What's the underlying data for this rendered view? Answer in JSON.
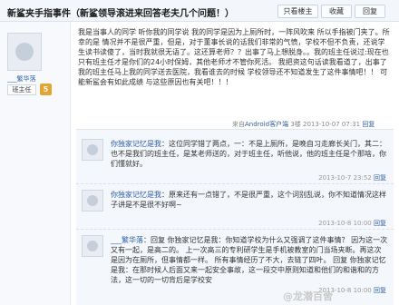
{
  "header": {
    "title": "新鲨夹手指事件（新鲨领导滚进来回答老夫几个问题！）",
    "buttons": {
      "only_author": "只看楼主",
      "favorite": "收藏",
      "reply": "回复"
    }
  },
  "op": {
    "username": "___繁华落",
    "role_badge": "班主任",
    "level_badge": "5",
    "body": "我是当事人的同学 听你我的同学说 我的同学是因为上厕所时，一阵风吹来 所以手指被门夹了。所幸的是 情况并不是很严重，但是，对于董事长说的话我们非常的气愤，学校不但不负责，还说学生读书读傻了，当时我就很无语了。这还算老师？？出事了马上想脱身。。我的班主任说过:现在也只有班主任才是你们的24小时保姆，其他老师才不管你死活。 我把资这句话读我看道了，出事了我的班主任马上我的同学送去医院，我看谁去的时候 学校领导还不知道发生了这件事情吧！！ 可能新鲨会有如此成绩 与这些原因也有关吧！！！",
    "meta": {
      "device_prefix": "来自",
      "device": "Android客户端",
      "floor": "3楼",
      "time": "2013-10-07 07:31",
      "reply_label": "回复"
    }
  },
  "replies": [
    {
      "username": "你独家记忆是我",
      "text": "这位同学错了两点，一：不是上厕所，是晚自习走廊长关门，其二：也不是我们的班主任，是某老师送的，对于班主任，听他说，他的班主任是个那啥，你们懂就好。",
      "time": "2013-10-7 23:52",
      "reply_label": "回复"
    },
    {
      "username": "你独家记忆是我",
      "text": "原来还有一点错了，不是很严重，这个词别乱说，你不知道情况这样子讲是不是很不好啊~",
      "time": "2013-10-8 10:00",
      "reply_label": "回复"
    },
    {
      "username": "___繁华落",
      "text": "回复 你独家记忆是我：你知道学校为什么又强调了这件事情？ 因为这一次又有一起，是高二的。 上一次高三的专利研学生是手机被教室的门当场夹断。再这次是因为在厕所，但事情都一样。 所有事情经历了不大，去链了四叶。 回复 你独家记忆是我：在那时候人后面又来一起安全事故，这一段交中原则知道和他们的和谐和的方法，这一切的一切背后是学校安",
      "time": "2013-10-8 10:00",
      "reply_label": "回复"
    }
  ],
  "watermark": "@龙潜百舍"
}
